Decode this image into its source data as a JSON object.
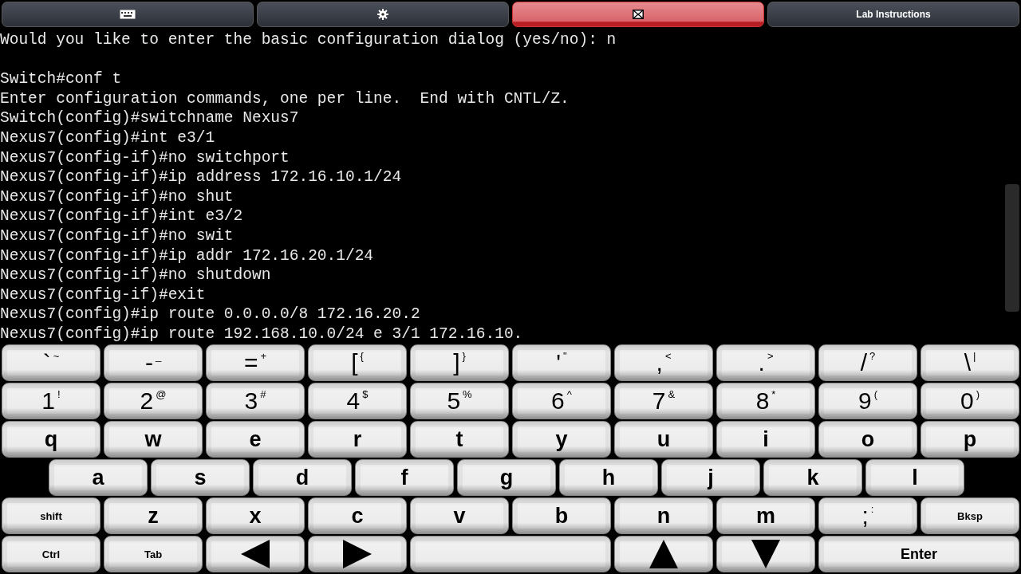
{
  "tabs": [
    {
      "kind": "keyboard",
      "selected": false
    },
    {
      "kind": "gear",
      "selected": false
    },
    {
      "kind": "envelope",
      "selected": true
    },
    {
      "kind": "text",
      "label": "Lab Instructions",
      "selected": false
    }
  ],
  "terminal": {
    "blocks": [
      [
        "Would you like to enter the basic configuration dialog (yes/no): n"
      ],
      [
        "Switch#conf t",
        "Enter configuration commands, one per line.  End with CNTL/Z.",
        "Switch(config)#switchname Nexus7",
        "Nexus7(config)#int e3/1",
        "Nexus7(config-if)#no switchport",
        "Nexus7(config-if)#ip address 172.16.10.1/24",
        "Nexus7(config-if)#no shut",
        "Nexus7(config-if)#int e3/2",
        "Nexus7(config-if)#no swit",
        "Nexus7(config-if)#ip addr 172.16.20.1/24",
        "Nexus7(config-if)#no shutdown",
        "Nexus7(config-if)#exit",
        "Nexus7(config)#ip route 0.0.0.0/8 172.16.20.2",
        "Nexus7(config)#ip route 192.168.10.0/24 e 3/1 172.16.10."
      ]
    ]
  },
  "keyboard": {
    "rows": [
      [
        {
          "kind": "char",
          "label": "`",
          "shift": "~"
        },
        {
          "kind": "char",
          "label": "-",
          "shift": "_"
        },
        {
          "kind": "char",
          "label": "=",
          "shift": "+"
        },
        {
          "kind": "char",
          "label": "[",
          "shift": "{"
        },
        {
          "kind": "char",
          "label": "]",
          "shift": "}"
        },
        {
          "kind": "char",
          "label": "'",
          "shift": "\""
        },
        {
          "kind": "char",
          "label": ",",
          "shift": "<"
        },
        {
          "kind": "char",
          "label": ".",
          "shift": ">"
        },
        {
          "kind": "char",
          "label": "/",
          "shift": "?"
        },
        {
          "kind": "char",
          "label": "\\",
          "shift": "|"
        }
      ],
      [
        {
          "kind": "char",
          "label": "1",
          "shift": "!"
        },
        {
          "kind": "char",
          "label": "2",
          "shift": "@"
        },
        {
          "kind": "char",
          "label": "3",
          "shift": "#"
        },
        {
          "kind": "char",
          "label": "4",
          "shift": "$"
        },
        {
          "kind": "char",
          "label": "5",
          "shift": "%"
        },
        {
          "kind": "char",
          "label": "6",
          "shift": "^"
        },
        {
          "kind": "char",
          "label": "7",
          "shift": "&"
        },
        {
          "kind": "char",
          "label": "8",
          "shift": "*"
        },
        {
          "kind": "char",
          "label": "9",
          "shift": "("
        },
        {
          "kind": "char",
          "label": "0",
          "shift": ")"
        }
      ],
      [
        {
          "kind": "letter",
          "label": "q"
        },
        {
          "kind": "letter",
          "label": "w"
        },
        {
          "kind": "letter",
          "label": "e"
        },
        {
          "kind": "letter",
          "label": "r"
        },
        {
          "kind": "letter",
          "label": "t"
        },
        {
          "kind": "letter",
          "label": "y"
        },
        {
          "kind": "letter",
          "label": "u"
        },
        {
          "kind": "letter",
          "label": "i"
        },
        {
          "kind": "letter",
          "label": "o"
        },
        {
          "kind": "letter",
          "label": "p"
        }
      ],
      [
        {
          "kind": "letter",
          "label": "a"
        },
        {
          "kind": "letter",
          "label": "s"
        },
        {
          "kind": "letter",
          "label": "d"
        },
        {
          "kind": "letter",
          "label": "f"
        },
        {
          "kind": "letter",
          "label": "g"
        },
        {
          "kind": "letter",
          "label": "h"
        },
        {
          "kind": "letter",
          "label": "j"
        },
        {
          "kind": "letter",
          "label": "k"
        },
        {
          "kind": "letter",
          "label": "l"
        }
      ],
      [
        {
          "kind": "word",
          "label": "shift"
        },
        {
          "kind": "letter",
          "label": "z"
        },
        {
          "kind": "letter",
          "label": "x"
        },
        {
          "kind": "letter",
          "label": "c"
        },
        {
          "kind": "letter",
          "label": "v"
        },
        {
          "kind": "letter",
          "label": "b"
        },
        {
          "kind": "letter",
          "label": "n"
        },
        {
          "kind": "letter",
          "label": "m"
        },
        {
          "kind": "char",
          "label": ";",
          "shift": ":"
        },
        {
          "kind": "word",
          "label": "Bksp"
        }
      ],
      [
        {
          "kind": "word",
          "label": "Ctrl"
        },
        {
          "kind": "word",
          "label": "Tab"
        },
        {
          "kind": "arrow-left"
        },
        {
          "kind": "arrow-right"
        },
        {
          "kind": "space"
        },
        {
          "kind": "arrow-up"
        },
        {
          "kind": "arrow-down"
        },
        {
          "kind": "enter",
          "label": "Enter"
        }
      ]
    ]
  }
}
